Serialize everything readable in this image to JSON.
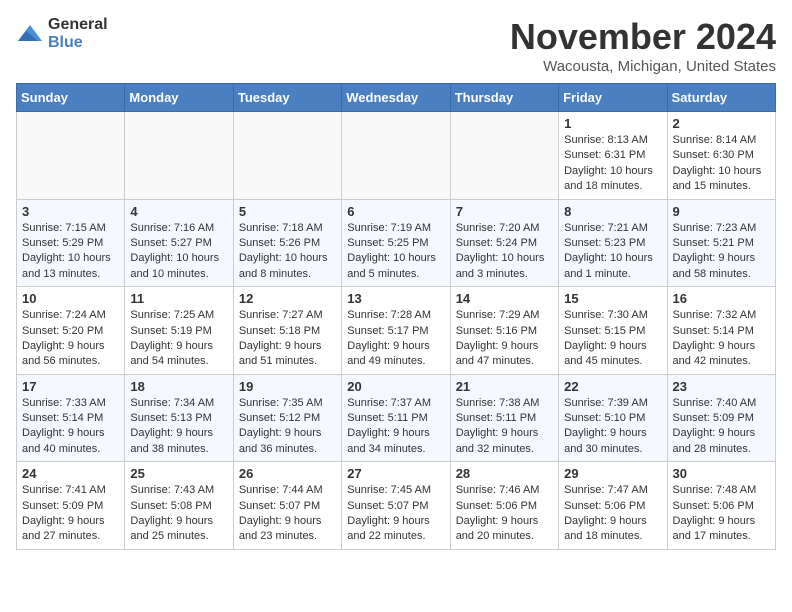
{
  "header": {
    "logo_general": "General",
    "logo_blue": "Blue",
    "month_year": "November 2024",
    "location": "Wacousta, Michigan, United States"
  },
  "weekdays": [
    "Sunday",
    "Monday",
    "Tuesday",
    "Wednesday",
    "Thursday",
    "Friday",
    "Saturday"
  ],
  "rows": [
    [
      {
        "day": "",
        "info": ""
      },
      {
        "day": "",
        "info": ""
      },
      {
        "day": "",
        "info": ""
      },
      {
        "day": "",
        "info": ""
      },
      {
        "day": "",
        "info": ""
      },
      {
        "day": "1",
        "info": "Sunrise: 8:13 AM\nSunset: 6:31 PM\nDaylight: 10 hours\nand 18 minutes."
      },
      {
        "day": "2",
        "info": "Sunrise: 8:14 AM\nSunset: 6:30 PM\nDaylight: 10 hours\nand 15 minutes."
      }
    ],
    [
      {
        "day": "3",
        "info": "Sunrise: 7:15 AM\nSunset: 5:29 PM\nDaylight: 10 hours\nand 13 minutes."
      },
      {
        "day": "4",
        "info": "Sunrise: 7:16 AM\nSunset: 5:27 PM\nDaylight: 10 hours\nand 10 minutes."
      },
      {
        "day": "5",
        "info": "Sunrise: 7:18 AM\nSunset: 5:26 PM\nDaylight: 10 hours\nand 8 minutes."
      },
      {
        "day": "6",
        "info": "Sunrise: 7:19 AM\nSunset: 5:25 PM\nDaylight: 10 hours\nand 5 minutes."
      },
      {
        "day": "7",
        "info": "Sunrise: 7:20 AM\nSunset: 5:24 PM\nDaylight: 10 hours\nand 3 minutes."
      },
      {
        "day": "8",
        "info": "Sunrise: 7:21 AM\nSunset: 5:23 PM\nDaylight: 10 hours\nand 1 minute."
      },
      {
        "day": "9",
        "info": "Sunrise: 7:23 AM\nSunset: 5:21 PM\nDaylight: 9 hours\nand 58 minutes."
      }
    ],
    [
      {
        "day": "10",
        "info": "Sunrise: 7:24 AM\nSunset: 5:20 PM\nDaylight: 9 hours\nand 56 minutes."
      },
      {
        "day": "11",
        "info": "Sunrise: 7:25 AM\nSunset: 5:19 PM\nDaylight: 9 hours\nand 54 minutes."
      },
      {
        "day": "12",
        "info": "Sunrise: 7:27 AM\nSunset: 5:18 PM\nDaylight: 9 hours\nand 51 minutes."
      },
      {
        "day": "13",
        "info": "Sunrise: 7:28 AM\nSunset: 5:17 PM\nDaylight: 9 hours\nand 49 minutes."
      },
      {
        "day": "14",
        "info": "Sunrise: 7:29 AM\nSunset: 5:16 PM\nDaylight: 9 hours\nand 47 minutes."
      },
      {
        "day": "15",
        "info": "Sunrise: 7:30 AM\nSunset: 5:15 PM\nDaylight: 9 hours\nand 45 minutes."
      },
      {
        "day": "16",
        "info": "Sunrise: 7:32 AM\nSunset: 5:14 PM\nDaylight: 9 hours\nand 42 minutes."
      }
    ],
    [
      {
        "day": "17",
        "info": "Sunrise: 7:33 AM\nSunset: 5:14 PM\nDaylight: 9 hours\nand 40 minutes."
      },
      {
        "day": "18",
        "info": "Sunrise: 7:34 AM\nSunset: 5:13 PM\nDaylight: 9 hours\nand 38 minutes."
      },
      {
        "day": "19",
        "info": "Sunrise: 7:35 AM\nSunset: 5:12 PM\nDaylight: 9 hours\nand 36 minutes."
      },
      {
        "day": "20",
        "info": "Sunrise: 7:37 AM\nSunset: 5:11 PM\nDaylight: 9 hours\nand 34 minutes."
      },
      {
        "day": "21",
        "info": "Sunrise: 7:38 AM\nSunset: 5:11 PM\nDaylight: 9 hours\nand 32 minutes."
      },
      {
        "day": "22",
        "info": "Sunrise: 7:39 AM\nSunset: 5:10 PM\nDaylight: 9 hours\nand 30 minutes."
      },
      {
        "day": "23",
        "info": "Sunrise: 7:40 AM\nSunset: 5:09 PM\nDaylight: 9 hours\nand 28 minutes."
      }
    ],
    [
      {
        "day": "24",
        "info": "Sunrise: 7:41 AM\nSunset: 5:09 PM\nDaylight: 9 hours\nand 27 minutes."
      },
      {
        "day": "25",
        "info": "Sunrise: 7:43 AM\nSunset: 5:08 PM\nDaylight: 9 hours\nand 25 minutes."
      },
      {
        "day": "26",
        "info": "Sunrise: 7:44 AM\nSunset: 5:07 PM\nDaylight: 9 hours\nand 23 minutes."
      },
      {
        "day": "27",
        "info": "Sunrise: 7:45 AM\nSunset: 5:07 PM\nDaylight: 9 hours\nand 22 minutes."
      },
      {
        "day": "28",
        "info": "Sunrise: 7:46 AM\nSunset: 5:06 PM\nDaylight: 9 hours\nand 20 minutes."
      },
      {
        "day": "29",
        "info": "Sunrise: 7:47 AM\nSunset: 5:06 PM\nDaylight: 9 hours\nand 18 minutes."
      },
      {
        "day": "30",
        "info": "Sunrise: 7:48 AM\nSunset: 5:06 PM\nDaylight: 9 hours\nand 17 minutes."
      }
    ]
  ]
}
